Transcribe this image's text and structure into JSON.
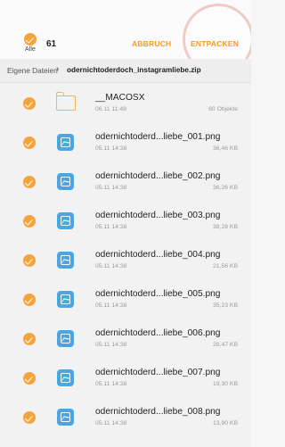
{
  "header": {
    "select_all_label": "Alle",
    "selected_count": "61",
    "cancel_label": "ABBRUCH",
    "extract_label": "ENTPACKEN"
  },
  "breadcrumb": {
    "root": "Eigene Dateien",
    "current": "odernichtoderdoch_instagramliebe.zip"
  },
  "colors": {
    "accent": "#f49a28",
    "check": "#f5a43d",
    "image_icon": "#4aa6e2"
  },
  "items": [
    {
      "icon": "folder-icon",
      "name": "__MACOSX",
      "date": "06.11 11:48",
      "meta": "60 Objekte"
    },
    {
      "icon": "image-file-icon",
      "name": "odernichtoderd...liebe_001.png",
      "date": "05.11 14:38",
      "meta": "36,46 KB"
    },
    {
      "icon": "image-file-icon",
      "name": "odernichtoderd...liebe_002.png",
      "date": "05.11 14:38",
      "meta": "36,26 KB"
    },
    {
      "icon": "image-file-icon",
      "name": "odernichtoderd...liebe_003.png",
      "date": "05.11 14:38",
      "meta": "38,28 KB"
    },
    {
      "icon": "image-file-icon",
      "name": "odernichtoderd...liebe_004.png",
      "date": "05.11 14:38",
      "meta": "21,56 KB"
    },
    {
      "icon": "image-file-icon",
      "name": "odernichtoderd...liebe_005.png",
      "date": "05.11 14:38",
      "meta": "35,23 KB"
    },
    {
      "icon": "image-file-icon",
      "name": "odernichtoderd...liebe_006.png",
      "date": "05.11 14:38",
      "meta": "28,47 KB"
    },
    {
      "icon": "image-file-icon",
      "name": "odernichtoderd...liebe_007.png",
      "date": "05.11 14:38",
      "meta": "19,30 KB"
    },
    {
      "icon": "image-file-icon",
      "name": "odernichtoderd...liebe_008.png",
      "date": "05.11 14:38",
      "meta": "13,90 KB"
    }
  ]
}
